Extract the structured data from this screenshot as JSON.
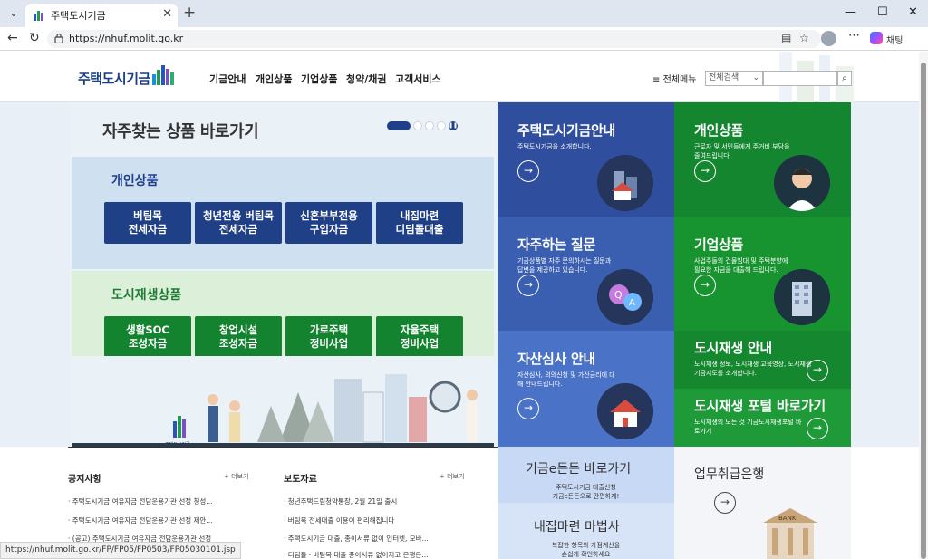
{
  "browser": {
    "tab_title": "주택도시기금",
    "url": "https://nhuf.molit.go.kr",
    "chat_label": "채팅",
    "status_url": "https://nhuf.molit.go.kr/FP/FP05/FP0503/FP05030101.jsp"
  },
  "header": {
    "logo": "주택도시기금",
    "nav": [
      "기금안내",
      "개인상품",
      "기업상품",
      "청약/채권",
      "고객서비스"
    ],
    "all_menu": "전체메뉴",
    "search_select": "전체검색"
  },
  "products": {
    "title": "자주찾는 상품 바로가기",
    "personal": {
      "label": "개인상품",
      "buttons": [
        [
          "버팀목",
          "전세자금"
        ],
        [
          "청년전용 버팀목",
          "전세자금"
        ],
        [
          "신혼부부전용",
          "구입자금"
        ],
        [
          "내집마련",
          "디딤돌대출"
        ]
      ]
    },
    "urban": {
      "label": "도시재생상품",
      "buttons": [
        [
          "생활SOC",
          "조성자금"
        ],
        [
          "창업시설",
          "조성자금"
        ],
        [
          "가로주택",
          "정비사업"
        ],
        [
          "자율주택",
          "정비사업"
        ]
      ]
    },
    "illus_logo": "주택도시기금"
  },
  "tiles": [
    {
      "title": "주택도시기금안내",
      "desc": "주택도시기금을 소개합니다.",
      "color": "#2f4f9e"
    },
    {
      "title": "개인상품",
      "desc": "근로자 및 서민들에게 주거비 부담을 줄여드립니다.",
      "color": "#13862f"
    },
    {
      "title": "자주하는 질문",
      "desc": "기금상품별 자주 문의하시는 질문과 답변을 제공하고 있습니다.",
      "color": "#3a5fb0"
    },
    {
      "title": "기업상품",
      "desc": "사업주들의 건물임대 및 주택분양에 필요한 자금을 대출해 드립니다.",
      "color": "#17932f"
    },
    {
      "title": "자산심사 안내",
      "desc": "자산심사, 의의신청 및 가산금리에 대해 안내드립니다.",
      "color": "#4a72c6"
    },
    {
      "title": "도시재생 안내",
      "desc": "도시재생 정보, 도시재생 교육영상, 도시재생 기금지도를 소개합니다.",
      "color": "#15872f"
    },
    {
      "title": "도시재생 포털 바로가기",
      "desc": "도시재생의 모든 것 기금도시재생포털 바로가기",
      "color": "#1f9a39"
    }
  ],
  "notice": {
    "title": "공지사항",
    "more": "+ 더보기",
    "items": [
      "주택도시기금 여유자금 전담운용기관 선정 청성...",
      "주택도시기금 여유자금 전담운용기관 선정 제안...",
      "(공고) 주택도시기금 여유자금 전담운용기관 선정"
    ]
  },
  "press": {
    "title": "보도자료",
    "more": "+ 더보기",
    "items": [
      "청년주택드림청약통장, 2월 21일 출시",
      "버팀목 전세대출 이용이 편리해집니다",
      "주택도시기금 대출, 종이서류 없이 인터넷, 모바...",
      "디딤돌ㆍ버팀목 대출 종이서류 없어지고 은행은..."
    ]
  },
  "bottom_tiles": {
    "egeum_title": "기금e든든 바로가기",
    "egeum_desc": [
      "주택도시기금 대출신청",
      "기금e든든으로 간편하게!"
    ],
    "magic_title": "내집마련 마법사",
    "magic_desc": [
      "복잡한 항목와 가점계산을",
      "손쉽게 확인하세요"
    ],
    "bank_title": "업무취급은행",
    "bank_sign": "BANK"
  }
}
